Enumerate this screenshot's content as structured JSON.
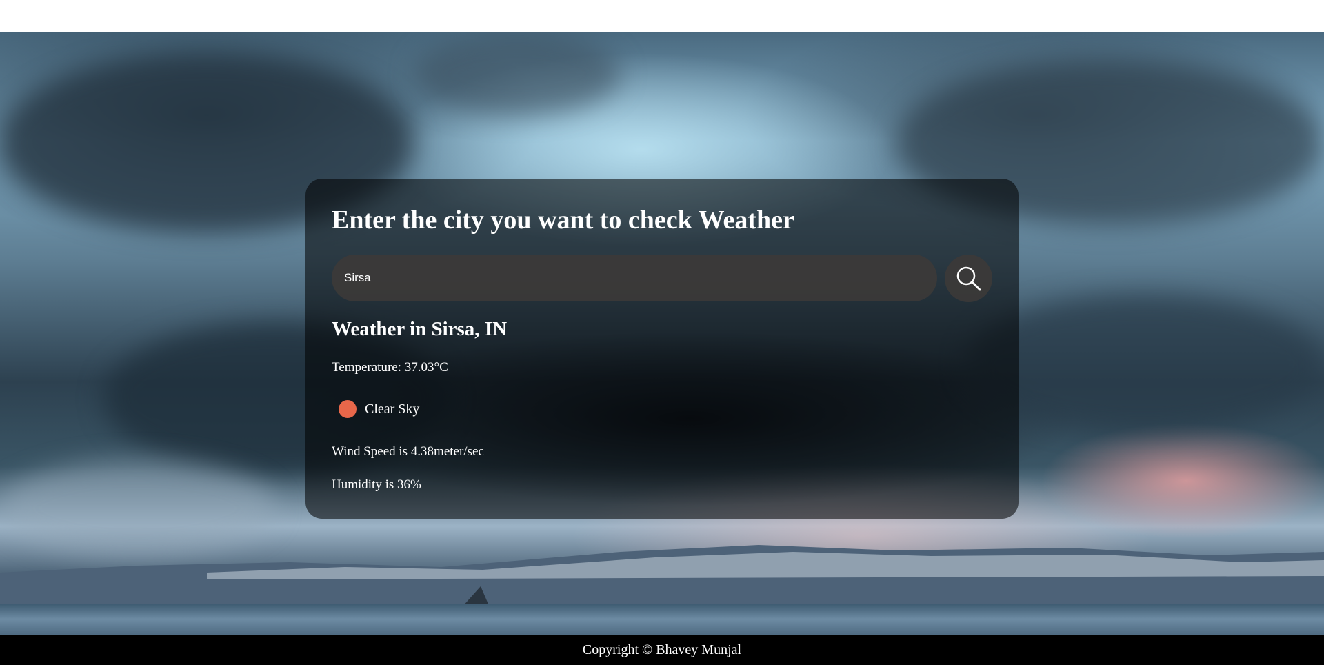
{
  "search": {
    "heading": "Enter the city you want to check Weather",
    "value": "Sirsa",
    "button_icon": "search-icon"
  },
  "weather": {
    "title": "Weather in Sirsa, IN",
    "temperature": "Temperature: 37.03°C",
    "condition": "Clear Sky",
    "condition_icon": "sun-icon",
    "wind": "Wind Speed is 4.38meter/sec",
    "humidity": "Humidity is 36%"
  },
  "footer": {
    "text": "Copyright © Bhavey Munjal"
  },
  "colors": {
    "card_bg": "rgba(0,0,0,0.55)",
    "input_bg": "#3c3a38",
    "sun": "#e8674a",
    "footer_bg": "#000000"
  }
}
